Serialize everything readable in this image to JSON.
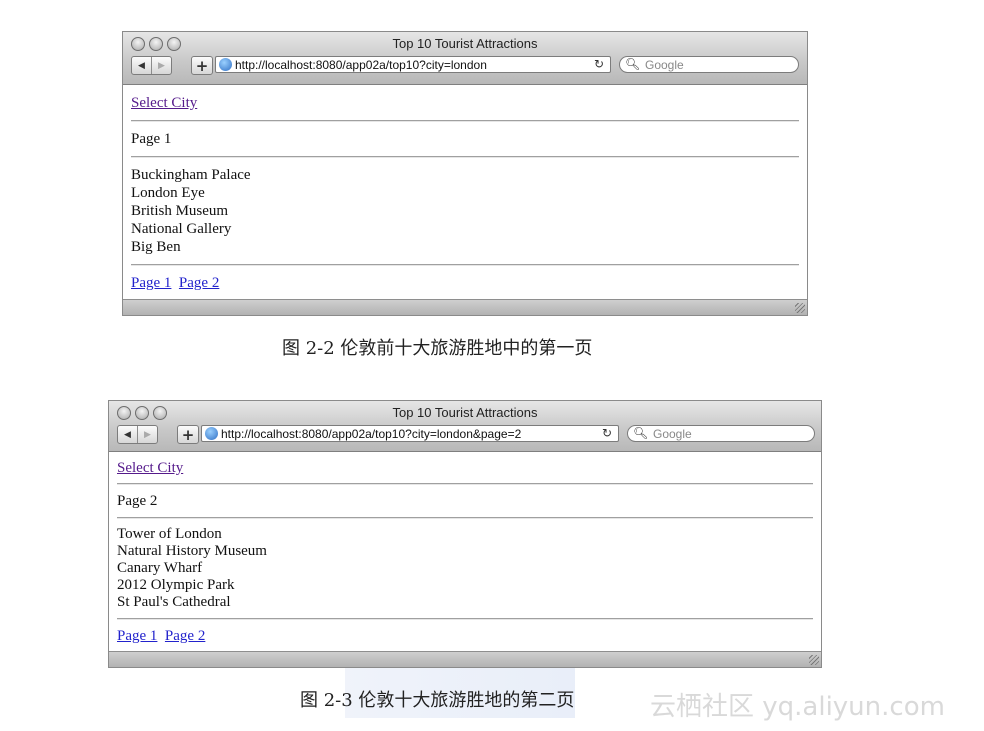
{
  "figures": [
    {
      "window_title": "Top 10 Tourist Attractions",
      "url": "http://localhost:8080/app02a/top10?city=london",
      "search_placeholder": "Google",
      "select_city": "Select City",
      "page_label": "Page 1",
      "attractions": [
        "Buckingham Palace",
        "London Eye",
        "British Museum",
        "National Gallery",
        "Big Ben"
      ],
      "page_links": [
        "Page 1",
        "Page 2"
      ],
      "caption": "图 2-2    伦敦前十大旅游胜地中的第一页"
    },
    {
      "window_title": "Top 10 Tourist Attractions",
      "url": "http://localhost:8080/app02a/top10?city=london&page=2",
      "search_placeholder": "Google",
      "select_city": "Select City",
      "page_label": "Page 2",
      "attractions": [
        "Tower of London",
        "Natural History Museum",
        "Canary Wharf",
        "2012 Olympic Park",
        "St Paul's Cathedral"
      ],
      "page_links": [
        "Page 1",
        "Page 2"
      ],
      "caption": "图 2-3    伦敦十大旅游胜地的第二页"
    }
  ],
  "watermark": "云栖社区 yq.aliyun.com"
}
